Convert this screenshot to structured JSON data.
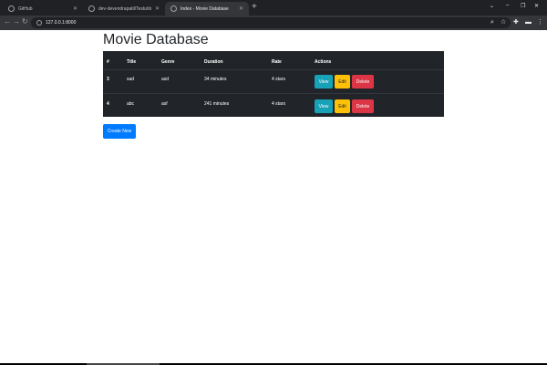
{
  "browser": {
    "tabs": [
      {
        "label": "GitHub"
      },
      {
        "label": "dev-devendrapatil/Testutils: This"
      },
      {
        "label": "Index - Movie Database"
      }
    ],
    "new_tab": "+",
    "url": "127.0.0.1:8000"
  },
  "page": {
    "title": "Movie Database",
    "table": {
      "headers": [
        "#",
        "Title",
        "Genre",
        "Duration",
        "Rate",
        "Actions"
      ],
      "rows": [
        {
          "id": "3",
          "title": "sad",
          "genre": "asd",
          "duration": "34 minutes",
          "rate": "4 stars"
        },
        {
          "id": "4",
          "title": "abc",
          "genre": "asf",
          "duration": "241 minutes",
          "rate": "4 stars"
        }
      ],
      "actions": {
        "view": "View",
        "edit": "Edit",
        "delete": "Delete"
      }
    },
    "create_label": "Create New"
  },
  "colors": {
    "view": "#17a2b8",
    "edit": "#ffc107",
    "delete": "#dc3545",
    "create": "#007bff",
    "table_bg": "#212529"
  }
}
